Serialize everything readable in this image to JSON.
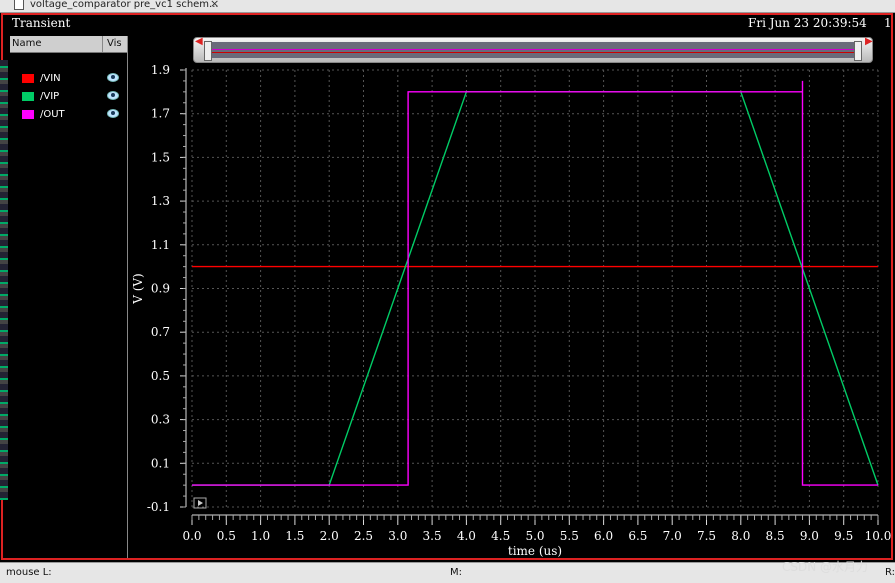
{
  "window": {
    "tab_title": "voltage_comparator pre_vc1 schem...",
    "tab_close": "×",
    "panel_title": "Transient",
    "datetime": "Fri Jun 23 20:39:54",
    "page_number": "1"
  },
  "legend": {
    "col_name": "Name",
    "col_vis": "Vis",
    "items": [
      {
        "label": "/VIN",
        "color": "#ff0000"
      },
      {
        "label": "/VIP",
        "color": "#00cc66"
      },
      {
        "label": "/OUT",
        "color": "#ff00ff"
      }
    ]
  },
  "status": {
    "mouse": "mouse L:",
    "middle": "M:",
    "right": "R:"
  },
  "watermark": "CSDN @水月力",
  "colors": {
    "frame": "#dd2222",
    "grid": "#555555",
    "plot_bg": "#000000"
  },
  "chart_data": {
    "type": "line",
    "title": "Transient",
    "xlabel": "time (us)",
    "ylabel": "V (V)",
    "xlim": [
      0,
      10
    ],
    "ylim": [
      -0.1,
      1.9
    ],
    "x_ticks": [
      "0.0",
      "0.5",
      "1.0",
      "1.5",
      "2.0",
      "2.5",
      "3.0",
      "3.5",
      "4.0",
      "4.5",
      "5.0",
      "5.5",
      "6.0",
      "6.5",
      "7.0",
      "7.5",
      "8.0",
      "8.5",
      "9.0",
      "9.5",
      "10.0"
    ],
    "y_ticks": [
      "1.9",
      "1.7",
      "1.5",
      "1.3",
      "1.1",
      "0.9",
      "0.7",
      "0.5",
      "0.3",
      "0.1",
      "-0.1"
    ],
    "y_tick_values": [
      1.9,
      1.7,
      1.5,
      1.3,
      1.1,
      0.9,
      0.7,
      0.5,
      0.3,
      0.1,
      -0.1
    ],
    "grid": true,
    "series": [
      {
        "name": "/VIN",
        "color": "#ff0000",
        "points": [
          [
            0,
            1.0
          ],
          [
            10,
            1.0
          ]
        ]
      },
      {
        "name": "/VIP",
        "color": "#00cc66",
        "points": [
          [
            0,
            0.0
          ],
          [
            2.0,
            0.0
          ],
          [
            4.0,
            1.8
          ],
          [
            8.0,
            1.8
          ],
          [
            10.0,
            0.0
          ]
        ]
      },
      {
        "name": "/OUT",
        "color": "#ff00ff",
        "points": [
          [
            0,
            0.0
          ],
          [
            3.15,
            0.0
          ],
          [
            3.15,
            1.8
          ],
          [
            8.9,
            1.8
          ],
          [
            8.9,
            1.85
          ],
          [
            8.9,
            0.0
          ],
          [
            10.0,
            0.0
          ]
        ]
      }
    ]
  }
}
